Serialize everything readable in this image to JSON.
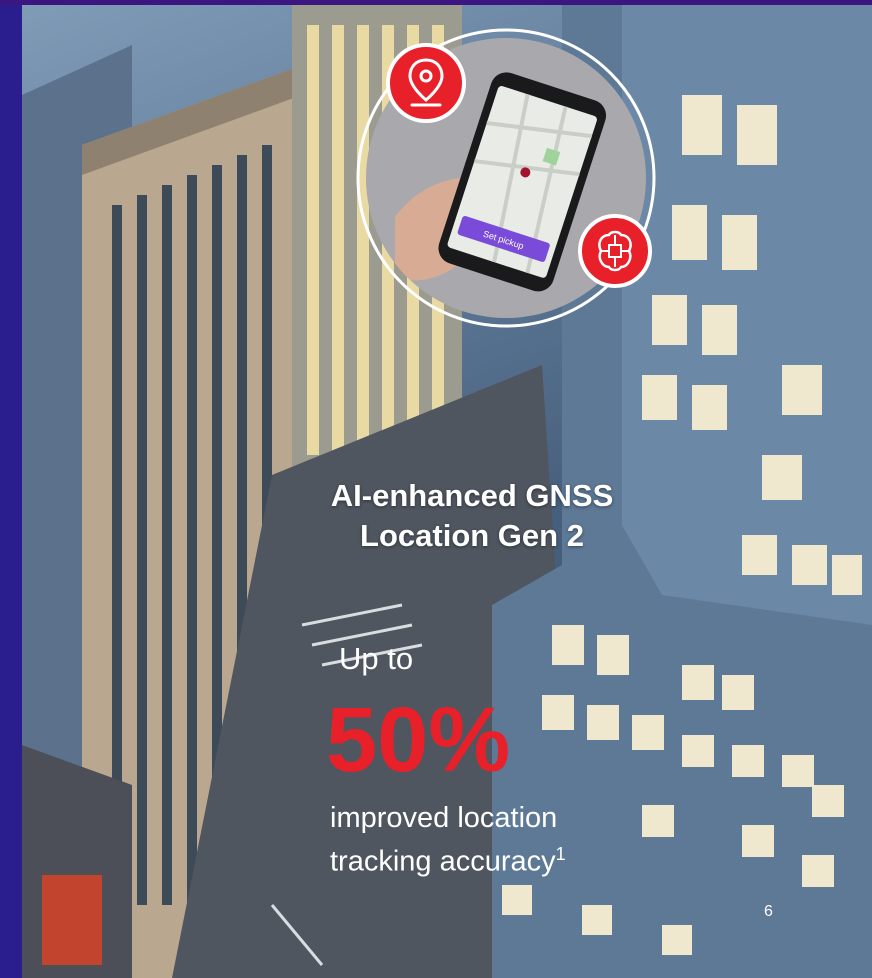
{
  "headline": {
    "line1": "AI-enhanced GNSS",
    "line2": "Location Gen 2"
  },
  "stat": {
    "prefix": "Up to",
    "value": "50%",
    "description_line1": "improved location",
    "description_line2": "tracking accuracy",
    "footnote_mark": "1"
  },
  "inset": {
    "phone_button": "Set pickup",
    "icons": [
      "location-pin-icon",
      "ai-brain-icon"
    ]
  },
  "page_number": "6",
  "colors": {
    "accent_red": "#e8202a",
    "frame_blue": "#2a1e8f",
    "top_bar": "#3b1680"
  }
}
